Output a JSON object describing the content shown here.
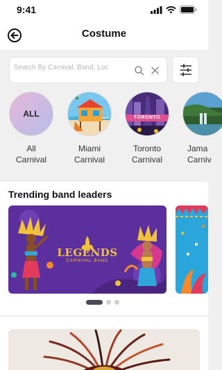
{
  "status_bar": {
    "time": "9:41"
  },
  "header": {
    "title": "Costume"
  },
  "search": {
    "placeholder": "Search By Carnival, Band, Loc"
  },
  "categories": [
    {
      "line1": "All",
      "line2": "Carnival",
      "circle_text": "ALL"
    },
    {
      "line1": "Miami",
      "line2": "Carnival"
    },
    {
      "line1": "Toronto",
      "line2": "Carnival",
      "badge": "TORONTO"
    },
    {
      "line1": "Jama",
      "line2": "Carniv"
    }
  ],
  "trending": {
    "heading": "Trending band leaders",
    "banner": {
      "logo_title": "LEGENDS",
      "logo_subtitle": "CARNIVAL BAND"
    },
    "slide_count": 3,
    "active_slide": 1
  },
  "colors": {
    "accent_purple": "#5b2f9e",
    "dot_active": "#4b4b58",
    "all_gradient_start": "#e6b7da",
    "all_gradient_end": "#b6bde8"
  }
}
